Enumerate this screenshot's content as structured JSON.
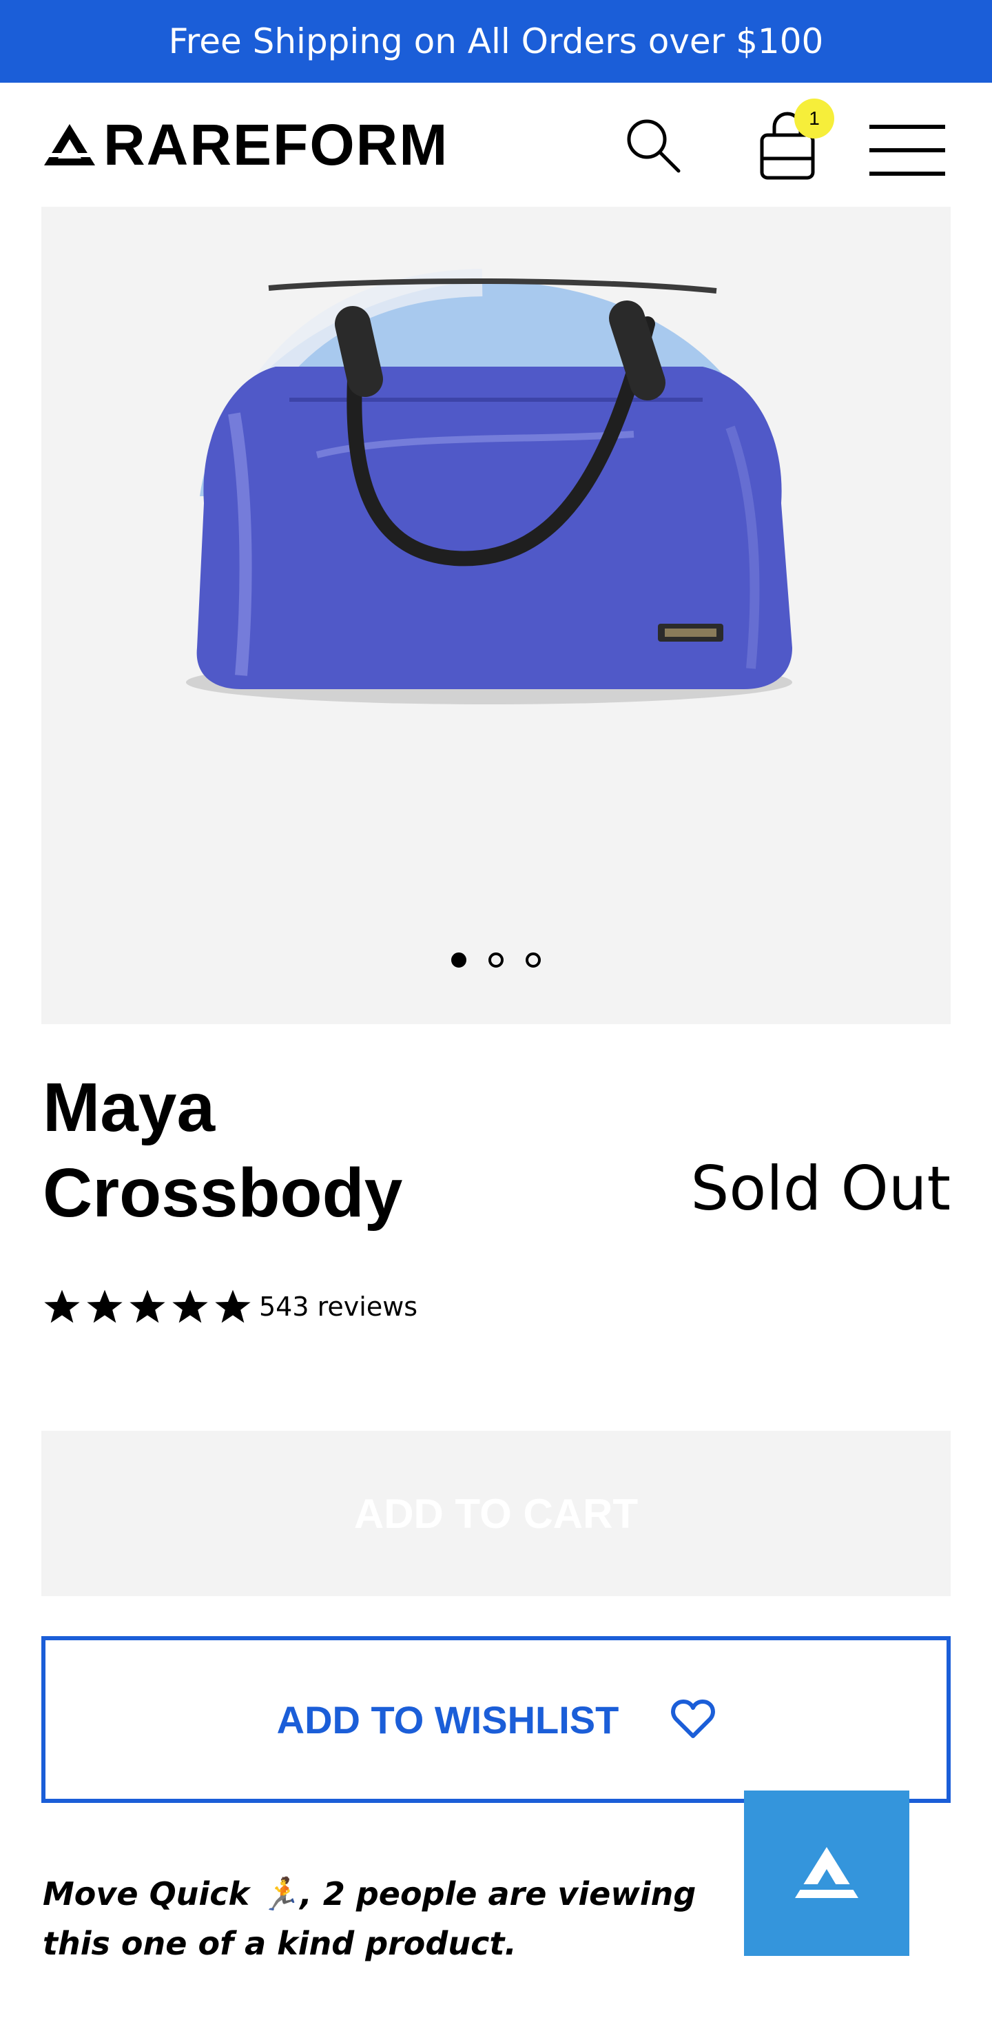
{
  "announcement": {
    "text": "Free Shipping on All Orders over $100"
  },
  "header": {
    "logo_text": "RAREFORM",
    "cart_count": "1"
  },
  "gallery": {
    "image_alt": "Maya Crossbody bag",
    "slides": 3,
    "active_slide": 1
  },
  "product": {
    "title_line1": "Maya",
    "title_line2": "Crossbody",
    "price_status": "Sold Out",
    "rating": 5,
    "reviews_label": "543 reviews"
  },
  "actions": {
    "add_to_cart_label": "ADD TO CART",
    "wishlist_label": "ADD TO WISHLIST"
  },
  "notice": {
    "text": "Move Quick 🏃, 2 people are viewing this one of a kind product."
  },
  "colors": {
    "accent": "#1b5ed8",
    "badge": "#f6ee3a",
    "float_button": "#3495dc",
    "gallery_bg": "#f3f3f3"
  },
  "icons": [
    "search-icon",
    "cart-icon",
    "menu-icon",
    "star-icon",
    "heart-icon",
    "rareform-logo-icon"
  ]
}
